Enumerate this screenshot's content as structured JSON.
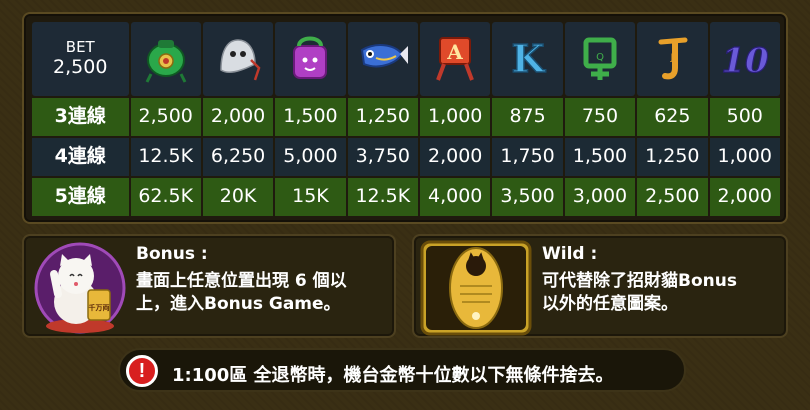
{
  "bet": {
    "label": "BET",
    "value": "2,500"
  },
  "symbols": [
    {
      "name": "lucky-bag-icon"
    },
    {
      "name": "ghost-charm-icon"
    },
    {
      "name": "purple-pouch-icon"
    },
    {
      "name": "carp-streamer-icon"
    },
    {
      "name": "card-a-icon",
      "text": "A"
    },
    {
      "name": "card-k-icon",
      "text": "K"
    },
    {
      "name": "card-q-icon",
      "text": "Q"
    },
    {
      "name": "card-j-icon",
      "text": "J"
    },
    {
      "name": "card-10-icon",
      "text": "10"
    }
  ],
  "rows": [
    {
      "label": "3連線",
      "values": [
        "2,500",
        "2,000",
        "1,500",
        "1,250",
        "1,000",
        "875",
        "750",
        "625",
        "500"
      ]
    },
    {
      "label": "4連線",
      "values": [
        "12.5K",
        "6,250",
        "5,000",
        "3,750",
        "2,000",
        "1,750",
        "1,500",
        "1,250",
        "1,000"
      ]
    },
    {
      "label": "5連線",
      "values": [
        "62.5K",
        "20K",
        "15K",
        "12.5K",
        "4,000",
        "3,500",
        "3,000",
        "2,500",
        "2,000"
      ]
    }
  ],
  "bonus": {
    "title": "Bonus :",
    "line1": "畫面上任意位置出現 6 個以",
    "line2": "上，進入Bonus Game。",
    "badge": "千万両"
  },
  "wild": {
    "title": "Wild :",
    "line1": "可代替除了招財貓Bonus",
    "line2": "以外的任意圖案。"
  },
  "notice": {
    "icon": "!",
    "text": "1:100區 全退幣時，機台金幣十位數以下無條件捨去。"
  },
  "colors": {
    "row_green": "#2e5a14",
    "row_slate": "#1c2a34",
    "background": "#3a2f14",
    "alert_red": "#d81f1f",
    "coin_gold": "#e8b83a"
  }
}
